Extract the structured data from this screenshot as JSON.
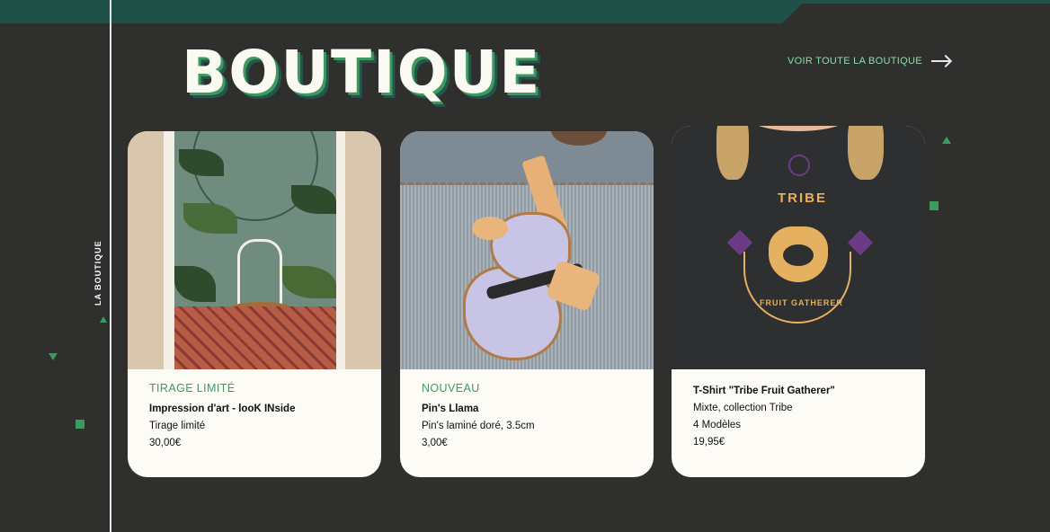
{
  "section": {
    "side_label": "LA BOUTIQUE",
    "heading": "BOUTIQUE",
    "see_all": "VOIR TOUTE LA BOUTIQUE"
  },
  "colors": {
    "background": "#2f2f2e",
    "accent_green": "#3c9a5f",
    "link_green": "#8ddcae",
    "card_bg": "#fdfbf6"
  },
  "products": [
    {
      "badge": "TIRAGE LIMITÉ",
      "title": "Impression d'art - looK INside",
      "detail": "Tirage limité",
      "price": "30,00€"
    },
    {
      "badge": "NOUVEAU",
      "title": "Pin's Llama",
      "detail": "Pin's laminé doré, 3.5cm",
      "price": "3,00€"
    },
    {
      "badge": "",
      "title": "T-Shirt \"Tribe Fruit Gatherer\"",
      "detail": "Mixte, collection Tribe",
      "models": "4 Modèles",
      "price": "19,95€"
    }
  ],
  "tshirt_print": {
    "top": "TRIBE",
    "bottom": "FRUIT GATHERER"
  }
}
